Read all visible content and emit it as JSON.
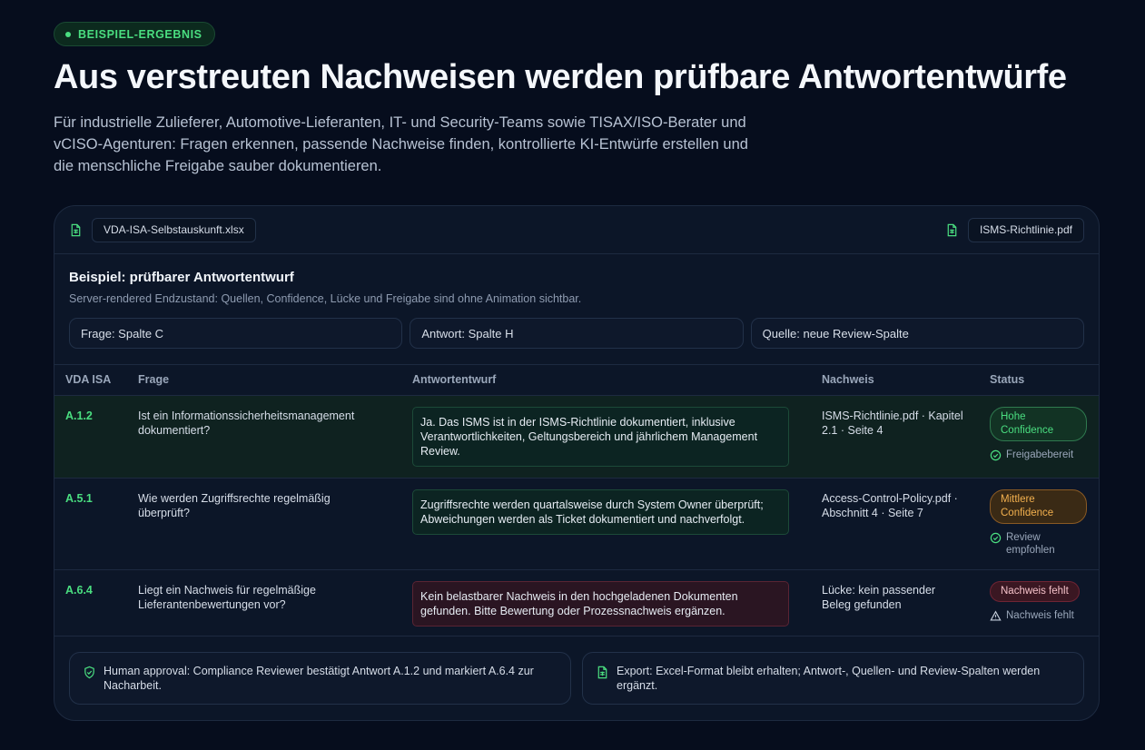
{
  "header": {
    "badge": "BEISPIEL-ERGEBNIS",
    "title": "Aus verstreuten Nachweisen werden prüfbare Antwortentwürfe",
    "intro": "Für industrielle Zulieferer, Automotive-Lieferanten, IT- und Security-Teams sowie TISAX/ISO-Berater und vCISO-Agenturen: Fragen erkennen, passende Nachweise finden, kontrollierte KI-Entwürfe erstellen und die menschliche Freigabe sauber dokumentieren."
  },
  "files": {
    "left": "VDA-ISA-Selbstauskunft.xlsx",
    "right": "ISMS-Richtlinie.pdf"
  },
  "example": {
    "title": "Beispiel: prüfbarer Antwortentwurf",
    "subtitle": "Server-rendered Endzustand: Quellen, Confidence, Lücke und Freigabe sind ohne Animation sichtbar.",
    "columns": [
      "Frage: Spalte C",
      "Antwort: Spalte H",
      "Quelle: neue Review-Spalte"
    ]
  },
  "table": {
    "headers": [
      "VDA ISA",
      "Frage",
      "Antwortentwurf",
      "Nachweis",
      "Status"
    ],
    "rows": [
      {
        "code": "A.1.2",
        "question": "Ist ein Informationssicherheitsmanagement dokumentiert?",
        "answer": "Ja. Das ISMS ist in der ISMS-Richtlinie dokumentiert, inklusive Verantwortlichkeiten, Geltungsbereich und jährlichem Management Review.",
        "evidence": "ISMS-Richtlinie.pdf · Kapitel 2.1 · Seite 4",
        "status": "Hohe Confidence",
        "note": "Freigabebereit"
      },
      {
        "code": "A.5.1",
        "question": "Wie werden Zugriffsrechte regelmäßig überprüft?",
        "answer": "Zugriffsrechte werden quartalsweise durch System Owner überprüft; Abweichungen werden als Ticket dokumentiert und nachverfolgt.",
        "evidence": "Access-Control-Policy.pdf · Abschnitt 4 · Seite 7",
        "status": "Mittlere Confidence",
        "note": "Review empfohlen"
      },
      {
        "code": "A.6.4",
        "question": "Liegt ein Nachweis für regelmäßige Lieferantenbewertungen vor?",
        "answer": "Kein belastbarer Nachweis in den hochgeladenen Dokumenten gefunden. Bitte Bewertung oder Prozessnachweis ergänzen.",
        "evidence": "Lücke: kein passender Beleg gefunden",
        "status": "Nachweis fehlt",
        "note": "Nachweis fehlt"
      }
    ]
  },
  "footer": {
    "approval": "Human approval: Compliance Reviewer bestätigt Antwort A.1.2 und markiert A.6.4 zur Nacharbeit.",
    "export": "Export: Excel-Format bleibt erhalten; Antwort-, Quellen- und Review-Spalten werden ergänzt."
  },
  "icons": {
    "file": "file-spreadsheet-icon",
    "check": "check-circle-icon",
    "warning": "warning-triangle-icon",
    "shield": "shield-check-icon"
  },
  "colors": {
    "accent": "#4ade80",
    "warning": "#f2b04e",
    "danger": "#6f2434",
    "background": "#060d1d"
  }
}
